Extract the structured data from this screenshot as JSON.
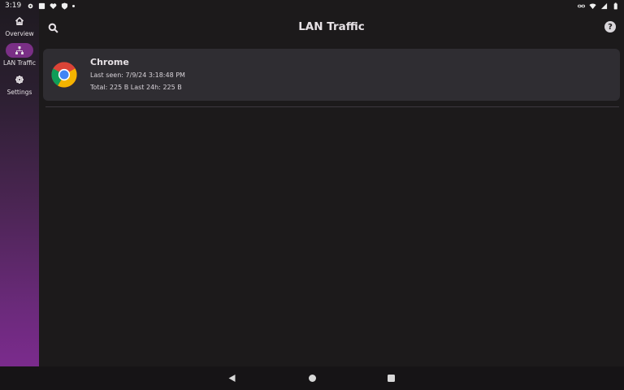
{
  "status_bar": {
    "time": "3:19",
    "left_icons": [
      "gear-icon",
      "a-box-icon",
      "heart-icon",
      "shield-icon",
      "dot-icon"
    ],
    "right_icons": [
      "link-icon",
      "wifi-icon",
      "signal-icon",
      "battery-icon"
    ]
  },
  "nav_rail": {
    "items": [
      {
        "label": "Overview",
        "icon": "home-icon",
        "active": false
      },
      {
        "label": "LAN Traffic",
        "icon": "network-icon",
        "active": true
      },
      {
        "label": "Settings",
        "icon": "gear-icon",
        "active": false
      }
    ]
  },
  "app_bar": {
    "title": "LAN Traffic",
    "help_label": "?"
  },
  "apps": [
    {
      "name": "Chrome",
      "last_seen": "Last seen: 7/9/24 3:18:48 PM",
      "totals": "Total: 225 B  Last 24h: 225 B"
    }
  ],
  "colors": {
    "background": "#1c1a1b",
    "card": "#2f2d32",
    "accent": "#7a2f86"
  }
}
